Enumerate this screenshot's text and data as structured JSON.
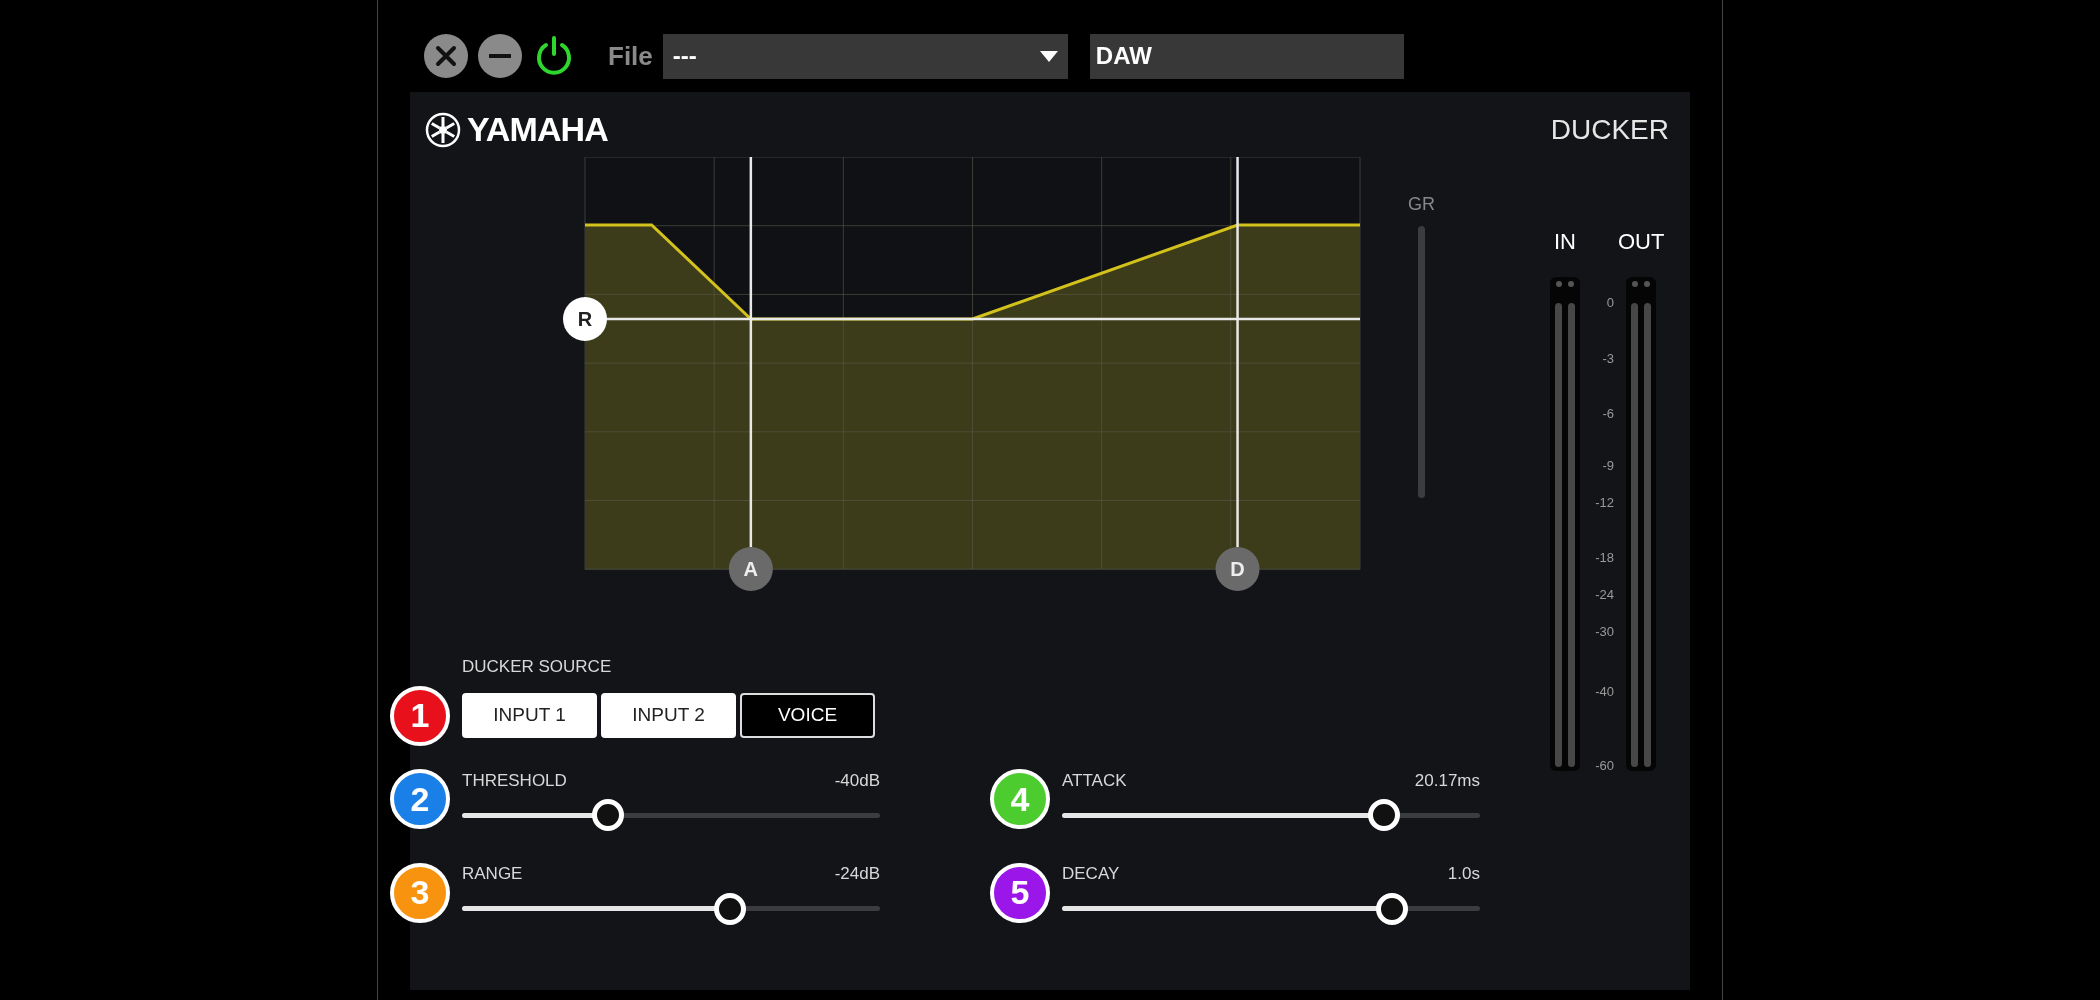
{
  "toolbar": {
    "file_label": "File",
    "file_value": "---",
    "name_value": "DAW"
  },
  "header": {
    "brand": "YAMAHA",
    "title": "DUCKER"
  },
  "graph": {
    "range_handle": "R",
    "attack_handle": "A",
    "decay_handle": "D",
    "gr_label": "GR"
  },
  "meters": {
    "in_label": "IN",
    "out_label": "OUT",
    "scale": [
      "0",
      "-3",
      "-6",
      "-9",
      "-12",
      "-18",
      "-24",
      "-30",
      "-40",
      "-60"
    ]
  },
  "ducker_source": {
    "label": "DUCKER SOURCE",
    "badge": "1",
    "color": "#e8101b",
    "options": [
      {
        "label": "INPUT 1",
        "selected": true
      },
      {
        "label": "INPUT 2",
        "selected": true
      },
      {
        "label": "VOICE",
        "selected": false
      }
    ]
  },
  "sliders": [
    {
      "label": "THRESHOLD",
      "value": "-40dB",
      "level": 0.35,
      "badge": "2",
      "color": "#1a7fe6"
    },
    {
      "label": "RANGE",
      "value": "-24dB",
      "level": 0.64,
      "badge": "3",
      "color": "#f7930e"
    },
    {
      "label": "ATTACK",
      "value": "20.17ms",
      "level": 0.77,
      "badge": "4",
      "color": "#4ccc2e"
    },
    {
      "label": "DECAY",
      "value": "1.0s",
      "level": 0.79,
      "badge": "5",
      "color": "#9b16e8"
    }
  ]
}
